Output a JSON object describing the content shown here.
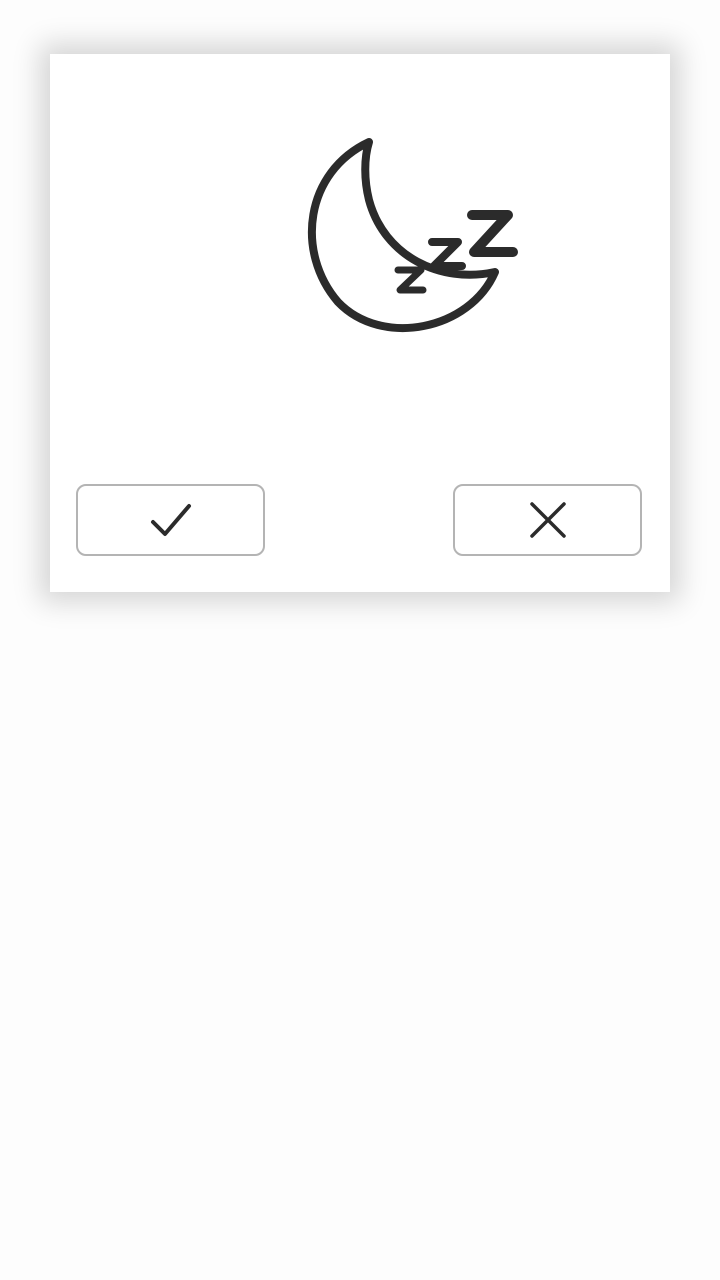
{
  "dialog": {
    "illustration_icon": "moon-zzz-sleep-icon",
    "confirm_button": {
      "icon": "checkmark-icon"
    },
    "cancel_button": {
      "icon": "close-icon"
    }
  },
  "colors": {
    "icon_stroke": "#2b2b2b",
    "button_border": "#b4b4b4",
    "dialog_background": "#ffffff",
    "page_background": "#fdfdfd"
  }
}
